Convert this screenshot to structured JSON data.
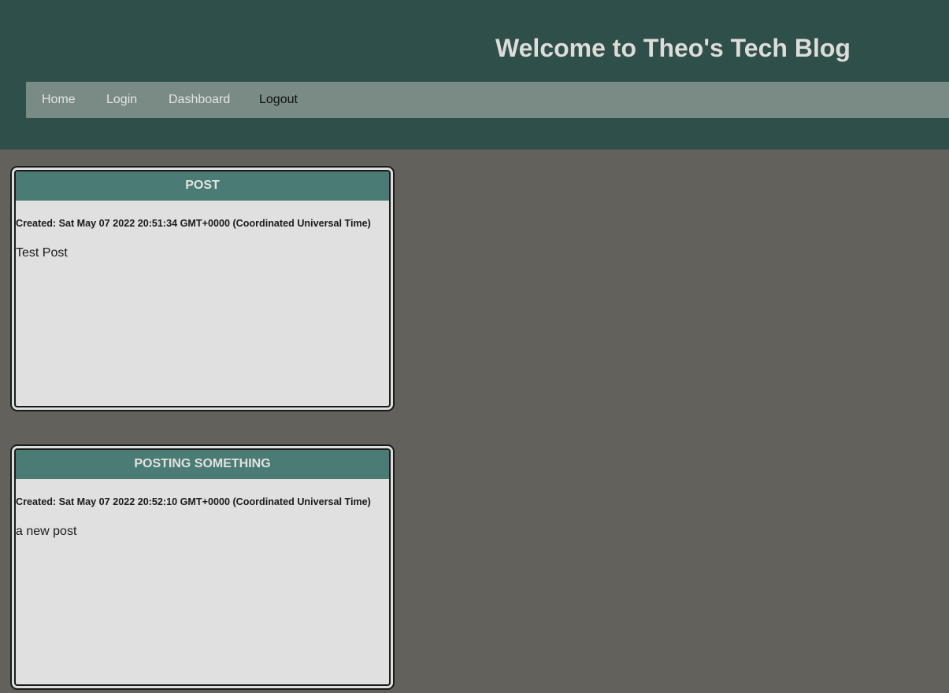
{
  "header": {
    "title": "Welcome to Theo's Tech Blog"
  },
  "nav": {
    "items": [
      {
        "label": "Home"
      },
      {
        "label": "Login"
      },
      {
        "label": "Dashboard"
      },
      {
        "label": "Logout"
      }
    ]
  },
  "posts": [
    {
      "title": "POST",
      "created": "Created: Sat May 07 2022 20:51:34 GMT+0000 (Coordinated Universal Time)",
      "content": "Test Post"
    },
    {
      "title": "POSTING SOMETHING",
      "created": "Created: Sat May 07 2022 20:52:10 GMT+0000 (Coordinated Universal Time)",
      "content": "a new post"
    }
  ],
  "colors": {
    "header_bg": "#2f4f4a",
    "nav_bg": "#7a8b86",
    "page_bg": "#62615c",
    "post_title_bg": "#4a7b74",
    "post_bg": "#e0e0e0"
  }
}
